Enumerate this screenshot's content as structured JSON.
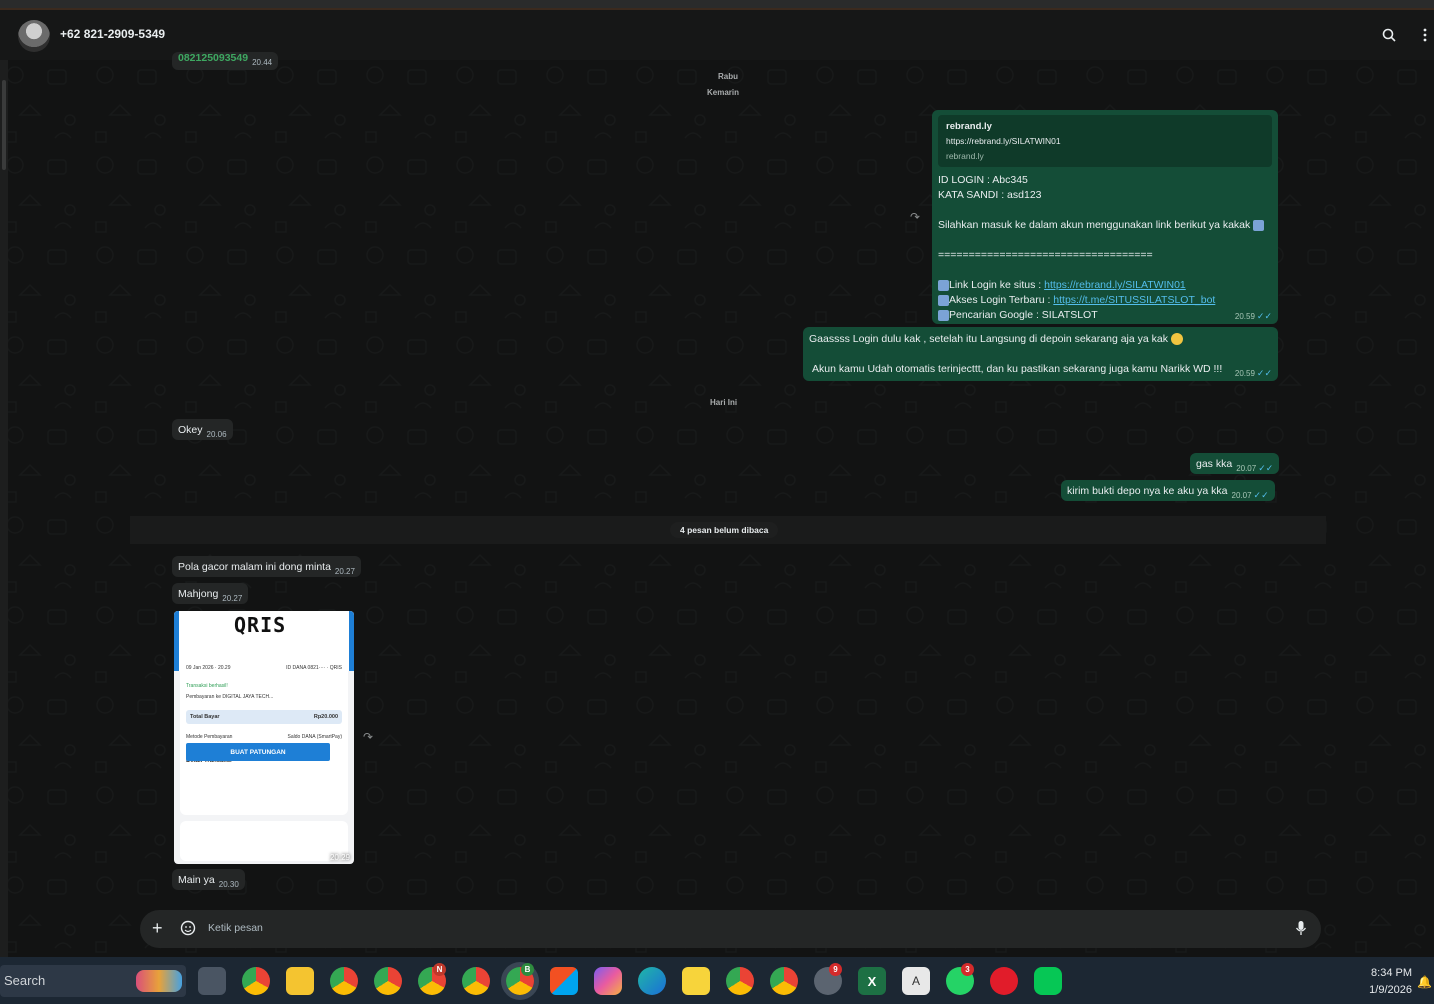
{
  "header": {
    "title": "+62 821-2909-5349"
  },
  "dates": {
    "rabu": "Rabu",
    "kemarin": "Kemarin",
    "hari_ini": "Hari Ini"
  },
  "partial_top": {
    "text": "082125093549",
    "time": "20.44"
  },
  "outgoing_1": {
    "preview_title": "rebrand.ly",
    "preview_url": "https://rebrand.ly/SILATWIN01",
    "preview_domain": "rebrand.ly",
    "line1": "ID LOGIN : Abc345",
    "line2": "KATA SANDI : asd123",
    "line3": "Silahkan masuk ke dalam akun menggunakan link berikut ya kakak",
    "line4": "===================================",
    "line5_label": "Link Login ke situs  : ",
    "line5_link": "https://rebrand.ly/SILATWIN01",
    "line6_label": "Akses Login Terbaru : ",
    "line6_link": "https://t.me/SITUSSILATSLOT_bot",
    "line7": "Pencarian Google : SILATSLOT",
    "time": "20.59"
  },
  "outgoing_2": {
    "line1": "Gaassss Login dulu kak , setelah itu Langsung di depoin sekarang aja ya kak",
    "line2": "Akun kamu Udah otomatis terinjecttt, dan ku pastikan sekarang juga kamu Narikk WD !!!",
    "time": "20.59"
  },
  "incoming_okey": {
    "text": "Okey",
    "time": "20.06"
  },
  "outgoing_gas": {
    "text": "gas kka",
    "time": "20.07"
  },
  "outgoing_kirim": {
    "text": "kirim bukti depo nya ke aku ya kka",
    "time": "20.07"
  },
  "unread_label": "4 pesan belum dibaca",
  "incoming_pola": {
    "text": "Pola gacor malam ini dong minta",
    "time": "20.27"
  },
  "incoming_mahjong": {
    "text": "Mahjong",
    "time": "20.27"
  },
  "image_msg": {
    "logo": "QRIS",
    "date": "09 Jan 2026 · 20.29",
    "ref": "ID DANA 0821···· · QRIS",
    "status": "Transaksi berhasil!",
    "merchant": "Pembayaran ke DIGITAL JAYA TECH...",
    "total_label": "Total Bayar",
    "total_value": "Rp20.000",
    "method_label": "Metode Pembayaran",
    "method_value": "Saldo DANA (SmartPay)",
    "detail_label": "Detail Transaksi",
    "button": "BUAT PATUNGAN",
    "time": "20.29"
  },
  "incoming_main": {
    "text": "Main ya",
    "time": "20.30"
  },
  "composer": {
    "placeholder": "Ketik pesan"
  },
  "taskbar": {
    "search_label": "Search",
    "time": "8:34 PM",
    "date": "1/9/2026",
    "badge_n": "N",
    "badge_b": "B",
    "badge_9": "9",
    "badge_3": "3",
    "word_a": "A"
  }
}
